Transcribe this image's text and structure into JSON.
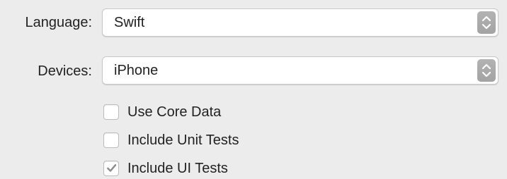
{
  "form": {
    "language": {
      "label": "Language:",
      "value": "Swift",
      "arrow_icon": "up-down-chevron-icon"
    },
    "devices": {
      "label": "Devices:",
      "value": "iPhone",
      "arrow_icon": "up-down-chevron-icon"
    },
    "options": [
      {
        "label": "Use Core Data",
        "checked": false
      },
      {
        "label": "Include Unit Tests",
        "checked": false
      },
      {
        "label": "Include UI Tests",
        "checked": true
      }
    ]
  },
  "colors": {
    "background": "#ececec",
    "control_background": "#ffffff",
    "popup_arrow_background": "#a8a8a8",
    "checkmark": "#8d8d8d"
  }
}
